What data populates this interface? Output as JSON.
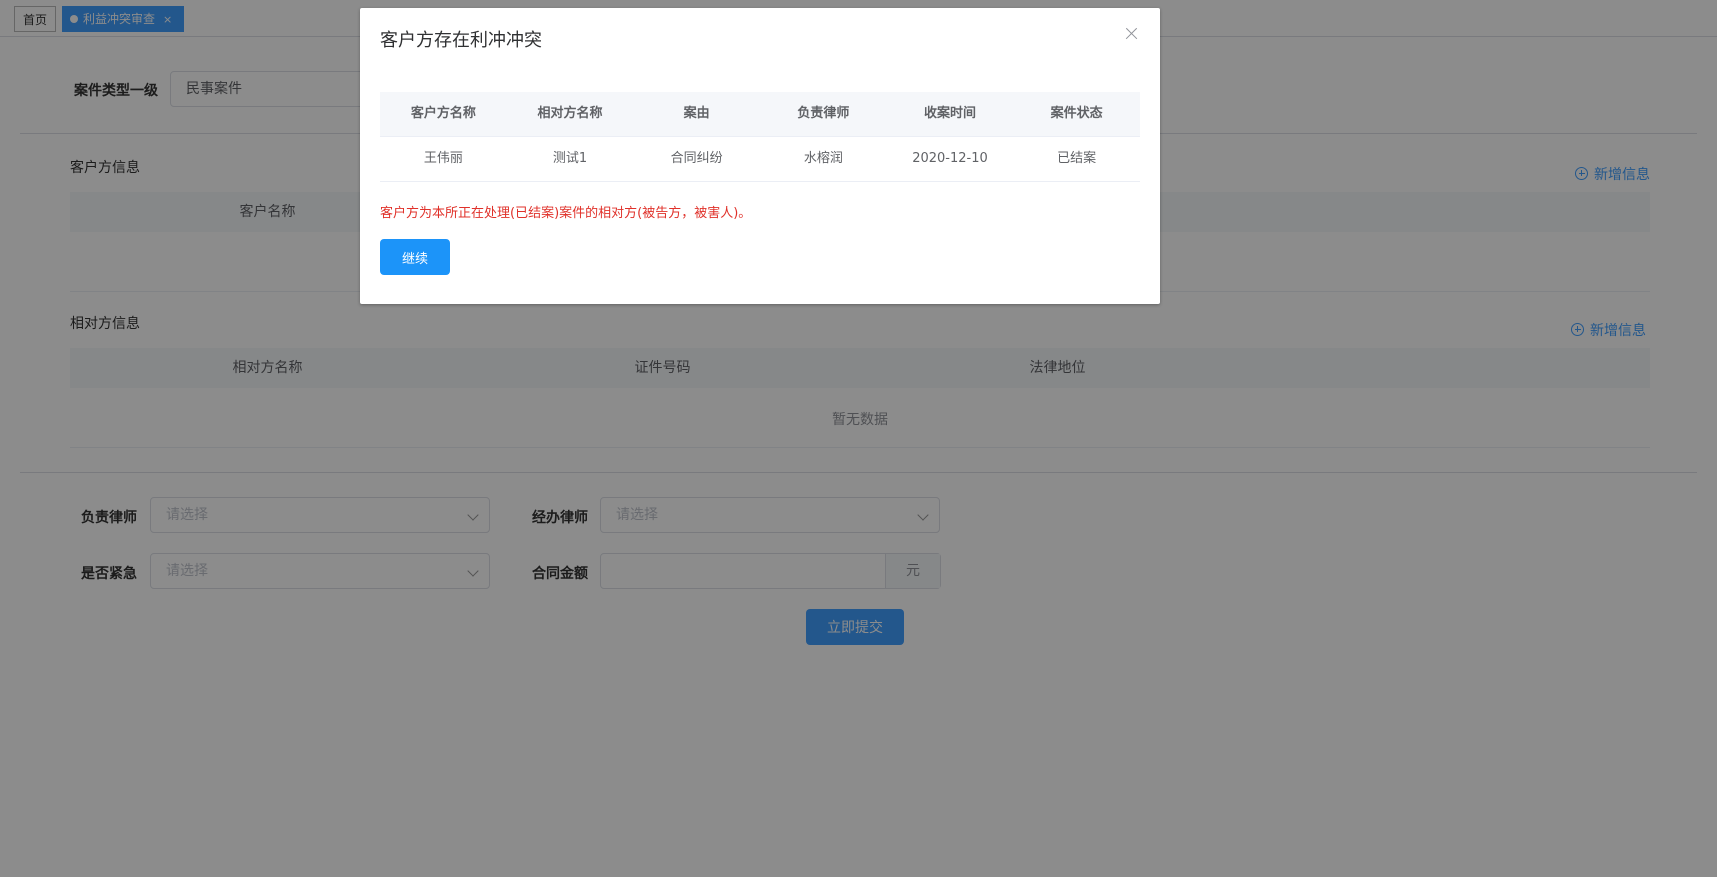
{
  "tabs": [
    {
      "label": "首页"
    },
    {
      "label": "利益冲突审查",
      "close": "×"
    }
  ],
  "case_type": {
    "label": "案件类型一级",
    "value": "民事案件"
  },
  "client_section": {
    "title": "客户方信息",
    "add_label": "新增信息",
    "columns": [
      "客户名称"
    ]
  },
  "opponent_section": {
    "title": "相对方信息",
    "add_label": "新增信息",
    "columns": [
      "相对方名称",
      "证件号码",
      "法律地位"
    ],
    "empty_text": "暂无数据"
  },
  "form": {
    "lead_lawyer": {
      "label": "负责律师",
      "placeholder": "请选择"
    },
    "handling_lawyer": {
      "label": "经办律师",
      "placeholder": "请选择"
    },
    "urgent": {
      "label": "是否紧急",
      "placeholder": "请选择"
    },
    "contract_amount": {
      "label": "合同金额",
      "value": "",
      "suffix": "元"
    },
    "submit_label": "立即提交"
  },
  "dialog": {
    "title": "客户方存在利冲冲突",
    "columns": [
      "客户方名称",
      "相对方名称",
      "案由",
      "负责律师",
      "收案时间",
      "案件状态"
    ],
    "rows": [
      [
        "王伟丽",
        "测试1",
        "合同纠纷",
        "水榕润",
        "2020-12-10",
        "已结案"
      ]
    ],
    "warning": "客户方为本所正在处理(已结案)案件的相对方(被告方，被害人)。",
    "continue_label": "继续"
  },
  "colors": {
    "primary": "#409eff",
    "continue_button": "#1c94f9",
    "warning_text": "#e0312a",
    "overlay": "rgba(0,0,0,0.45)"
  }
}
